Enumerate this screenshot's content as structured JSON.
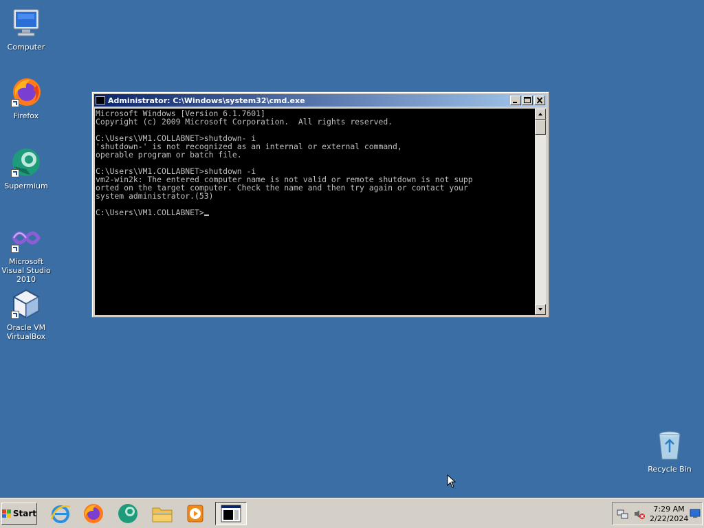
{
  "desktop_icons": [
    {
      "label": "Computer"
    },
    {
      "label": "Firefox"
    },
    {
      "label": "Supermium"
    },
    {
      "label": "Microsoft Visual Studio 2010"
    },
    {
      "label": "Oracle VM VirtualBox"
    },
    {
      "label": "Recycle Bin"
    }
  ],
  "cmd": {
    "title": "Administrator: C:\\Windows\\system32\\cmd.exe",
    "lines": [
      "Microsoft Windows [Version 6.1.7601]",
      "Copyright (c) 2009 Microsoft Corporation.  All rights reserved.",
      "",
      "C:\\Users\\VM1.COLLABNET>shutdown- i",
      "'shutdown-' is not recognized as an internal or external command,",
      "operable program or batch file.",
      "",
      "C:\\Users\\VM1.COLLABNET>shutdown -i",
      "vm2-win2k: The entered computer name is not valid or remote shutdown is not supp",
      "orted on the target computer. Check the name and then try again or contact your",
      "system administrator.(53)",
      ""
    ],
    "prompt": "C:\\Users\\VM1.COLLABNET>"
  },
  "taskbar": {
    "start_label": "Start",
    "clock_time": "7:29 AM",
    "clock_date": "2/22/2024"
  },
  "icons": {
    "minimize": "minimize-icon",
    "maximize": "maximize-icon",
    "close": "close-icon"
  },
  "colors": {
    "desktop": "#3a6ea5",
    "titlebar_start": "#0a246a",
    "console_bg": "#000000",
    "console_fg": "#c0c0c0"
  }
}
